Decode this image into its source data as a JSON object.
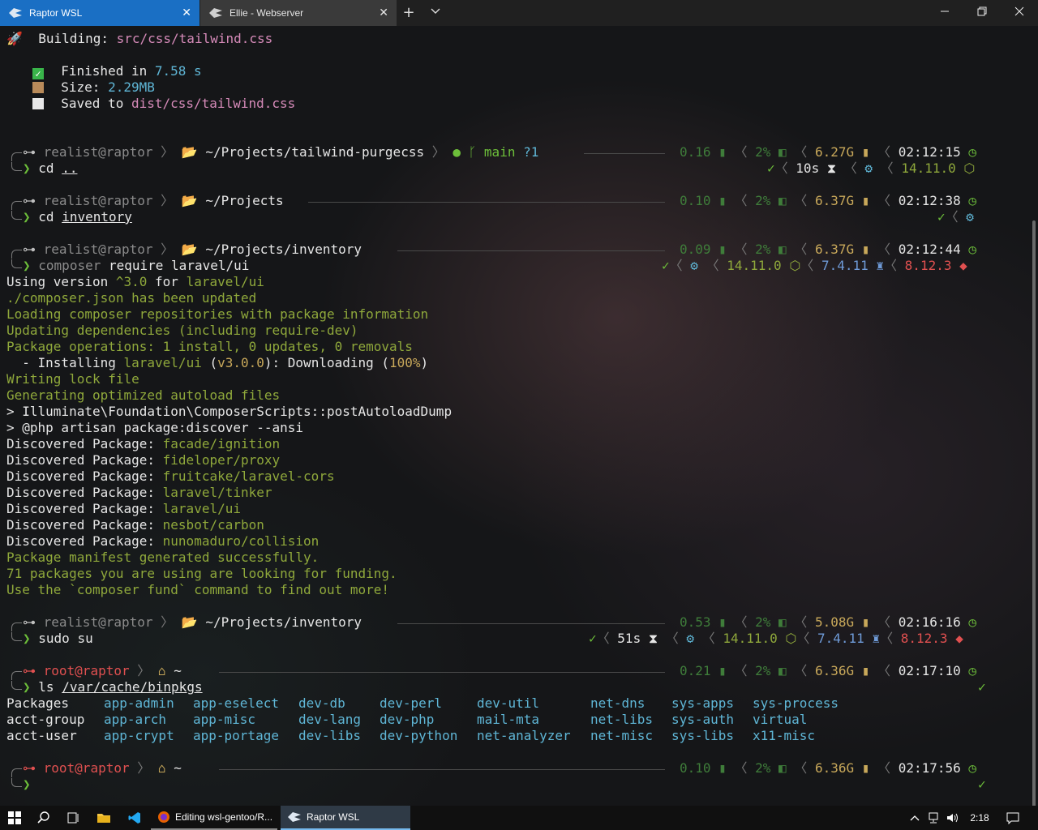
{
  "tabs": [
    {
      "label": "Raptor WSL",
      "active": true
    },
    {
      "label": "Ellie - Webserver",
      "active": false
    }
  ],
  "tabbar": {
    "new_tab": "+",
    "dropdown": "⌵"
  },
  "build": {
    "building_label": "Building:",
    "building_path": "src/css/tailwind.css",
    "finished_label": "Finished in",
    "finished_value": "7.58",
    "finished_unit": "s",
    "size_label": "Size:",
    "size_value": "2.29MB",
    "saved_label": "Saved to",
    "saved_path": "dist/css/tailwind.css"
  },
  "prompts": [
    {
      "user": "realist@raptor",
      "dir_prefix": "~/Projects/",
      "dir_last": "tailwind-purgecss",
      "git_branch": "main",
      "git_status": "?1",
      "cmd": "cd",
      "arg": "..",
      "load": "0.16",
      "cpu": "2%",
      "mem": "6.27G",
      "time": "02:12:15",
      "duration": "10s",
      "node": "14.11.0"
    },
    {
      "user": "realist@raptor",
      "dir_prefix": "~/Projects",
      "dir_last": "",
      "cmd": "cd",
      "arg": "inventory",
      "load": "0.10",
      "cpu": "2%",
      "mem": "6.37G",
      "time": "02:12:38"
    },
    {
      "user": "realist@raptor",
      "dir_prefix": "~/Projects/",
      "dir_last": "inventory",
      "cmd": "composer",
      "arg": "require laravel/ui",
      "load": "0.09",
      "cpu": "2%",
      "mem": "6.37G",
      "time": "02:12:44",
      "node": "14.11.0",
      "php": "7.4.11",
      "ruby": "8.12.3"
    },
    {
      "user": "realist@raptor",
      "dir_prefix": "~/Projects/",
      "dir_last": "inventory",
      "cmd": "sudo",
      "arg": "su",
      "load": "0.53",
      "cpu": "2%",
      "mem": "5.08G",
      "time": "02:16:16",
      "duration": "51s",
      "node": "14.11.0",
      "php": "7.4.11",
      "ruby": "8.12.3"
    },
    {
      "user": "root@raptor",
      "dir_prefix": "~",
      "cmd": "ls",
      "arg": "/var/cache/binpkgs",
      "load": "0.21",
      "cpu": "2%",
      "mem": "6.36G",
      "time": "02:17:10"
    },
    {
      "user": "root@raptor",
      "dir_prefix": "~",
      "cmd": "",
      "arg": "",
      "load": "0.10",
      "cpu": "2%",
      "mem": "6.36G",
      "time": "02:17:56"
    }
  ],
  "composer_output": {
    "l1a": "Using version ",
    "l1b": "^3.0",
    "l1c": " for ",
    "l1d": "laravel/ui",
    "l2": "./composer.json has been updated",
    "l3": "Loading composer repositories with package information",
    "l4": "Updating dependencies (including require-dev)",
    "l5": "Package operations: 1 install, 0 updates, 0 removals",
    "l6a": "  - Installing ",
    "l6b": "laravel/ui",
    "l6c": " (",
    "l6d": "v3.0.0",
    "l6e": "): Downloading (",
    "l6f": "100%",
    "l6g": ")",
    "l7": "Writing lock file",
    "l8": "Generating optimized autoload files",
    "l9": "> Illuminate\\Foundation\\ComposerScripts::postAutoloadDump",
    "l10": "> @php artisan package:discover --ansi",
    "discovered_label": "Discovered Package: ",
    "packages": [
      "facade/ignition",
      "fideloper/proxy",
      "fruitcake/laravel-cors",
      "laravel/tinker",
      "laravel/ui",
      "nesbot/carbon",
      "nunomaduro/collision"
    ],
    "l18": "Package manifest generated successfully.",
    "l19": "71 packages you are using are looking for funding.",
    "l20": "Use the `composer fund` command to find out more!"
  },
  "ls_output": [
    [
      "Packages",
      "app-admin",
      "app-eselect",
      "dev-db",
      "dev-perl",
      "dev-util",
      "net-dns",
      "sys-apps",
      "sys-process"
    ],
    [
      "acct-group",
      "app-arch",
      "app-misc",
      "dev-lang",
      "dev-php",
      "mail-mta",
      "net-libs",
      "sys-auth",
      "virtual"
    ],
    [
      "acct-user",
      "app-crypt",
      "app-portage",
      "dev-libs",
      "dev-python",
      "net-analyzer",
      "net-misc",
      "sys-libs",
      "x11-misc"
    ]
  ],
  "taskbar": {
    "apps": [
      {
        "label": "Editing wsl-gentoo/R...",
        "active": false
      },
      {
        "label": "Raptor WSL",
        "active": true
      }
    ],
    "clock": "2:18"
  },
  "colors": {
    "accent": "#1a6fc4",
    "prompt_green": "#6dbf3a",
    "dir_yellow": "#c8a85a",
    "node_green": "#8fa83b",
    "php_blue": "#6f9bd8",
    "ruby_red": "#e05050"
  }
}
